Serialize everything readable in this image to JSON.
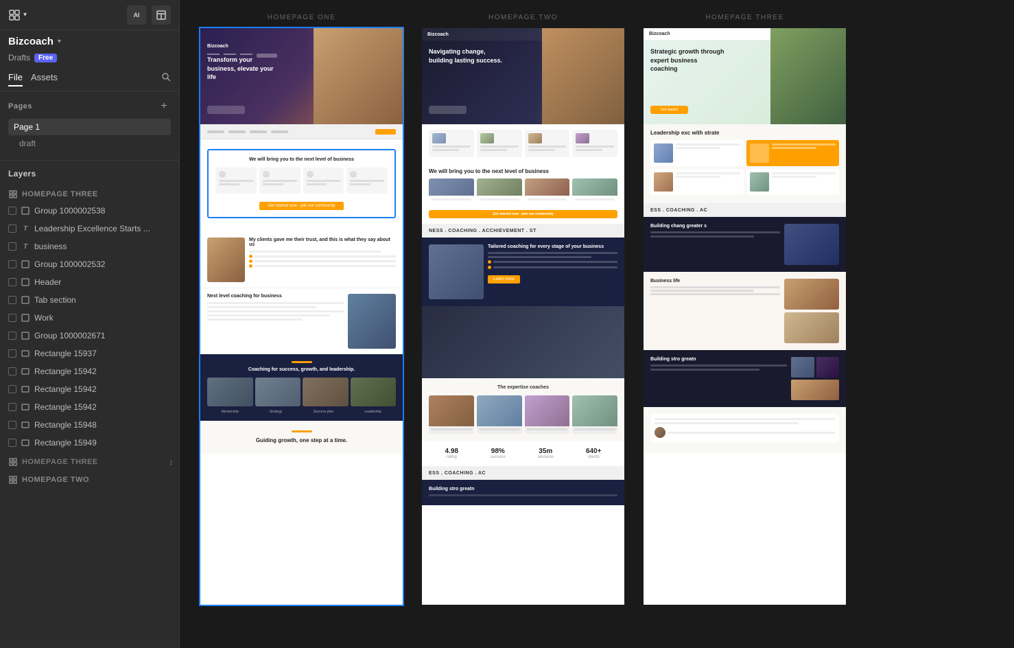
{
  "app": {
    "icon": "grid-icon",
    "title": "Bizcoach",
    "subtitle_drafts": "Drafts",
    "subtitle_badge": "Free"
  },
  "toolbar": {
    "ai_icon": "AI",
    "layout_icon": "layout"
  },
  "sidebar_tabs": {
    "file": "File",
    "assets": "Assets"
  },
  "pages": {
    "label": "Pages",
    "items": [
      {
        "label": "Page 1",
        "active": true
      },
      {
        "label": "draft",
        "active": false
      }
    ]
  },
  "layers": {
    "label": "Layers",
    "sections": [
      {
        "name": "HOMEPAGE THREE",
        "type": "section",
        "active": true,
        "items": [
          {
            "type": "group",
            "label": "Group 1000002538"
          },
          {
            "type": "text",
            "label": "Leadership Excellence Starts ..."
          },
          {
            "type": "text",
            "label": "business"
          },
          {
            "type": "group",
            "label": "Group 1000002532"
          },
          {
            "type": "group",
            "label": "Header"
          },
          {
            "type": "group",
            "label": "Tab section"
          },
          {
            "type": "group",
            "label": "Work"
          },
          {
            "type": "group",
            "label": "Group 1000002671"
          },
          {
            "type": "rect",
            "label": "Rectangle 15937"
          },
          {
            "type": "rect",
            "label": "Rectangle 15942"
          },
          {
            "type": "rect",
            "label": "Rectangle 15942"
          },
          {
            "type": "rect",
            "label": "Rectangle 15942"
          },
          {
            "type": "rect",
            "label": "Rectangle 15948"
          },
          {
            "type": "rect",
            "label": "Rectangle 15949"
          }
        ]
      },
      {
        "name": "HOMEPAGE THREE",
        "type": "section",
        "collapsed": true,
        "items": []
      },
      {
        "name": "HOMEPAGE TWO",
        "type": "section",
        "items": []
      }
    ]
  },
  "canvas": {
    "pages": [
      {
        "label": "HOMEPAGE ONE",
        "selected": true
      },
      {
        "label": "HOMEPAGE TWO",
        "selected": false
      },
      {
        "label": "HOMEPAGE THREE",
        "selected": false
      }
    ]
  },
  "homepage_one": {
    "hero_text": "Transform your business, elevate your life",
    "section2_title": "We will bring you to the next level of business",
    "testimonial_title": "My clients gave me their trust, and this is what they say about us",
    "coaching_title": "Next level coaching for business",
    "footer_title": "Coaching for success, growth, and leadership.",
    "footer_bottom_title": "Guiding growth, one step at a time."
  },
  "homepage_two": {
    "hero_text": "Navigating change, building lasting success.",
    "section2_title": "We will bring you to the next level of business",
    "marquee_text": "NESS . COACHING . ACCHIEVEMENT . ST",
    "coaching_title": "Tailored coaching for every stage of your business",
    "coaches_title": "The expertise coaches",
    "stats": [
      {
        "num": "4.98",
        "label": "rating"
      },
      {
        "num": "98%",
        "label": "success"
      },
      {
        "num": "35m",
        "label": "sessions"
      },
      {
        "num": "640+",
        "label": "clients"
      }
    ],
    "marquee2_text": "ESS . COACHING . AC"
  },
  "homepage_three": {
    "hero_text": "Strategic growth through expert business coaching",
    "info_title": "Leadership exc with strate",
    "marquee_text": "ESS . COACHING . AC",
    "dark_title": "Building chang greater s",
    "warm_title": "Business life",
    "bottom_title": "Building stro greatn"
  }
}
